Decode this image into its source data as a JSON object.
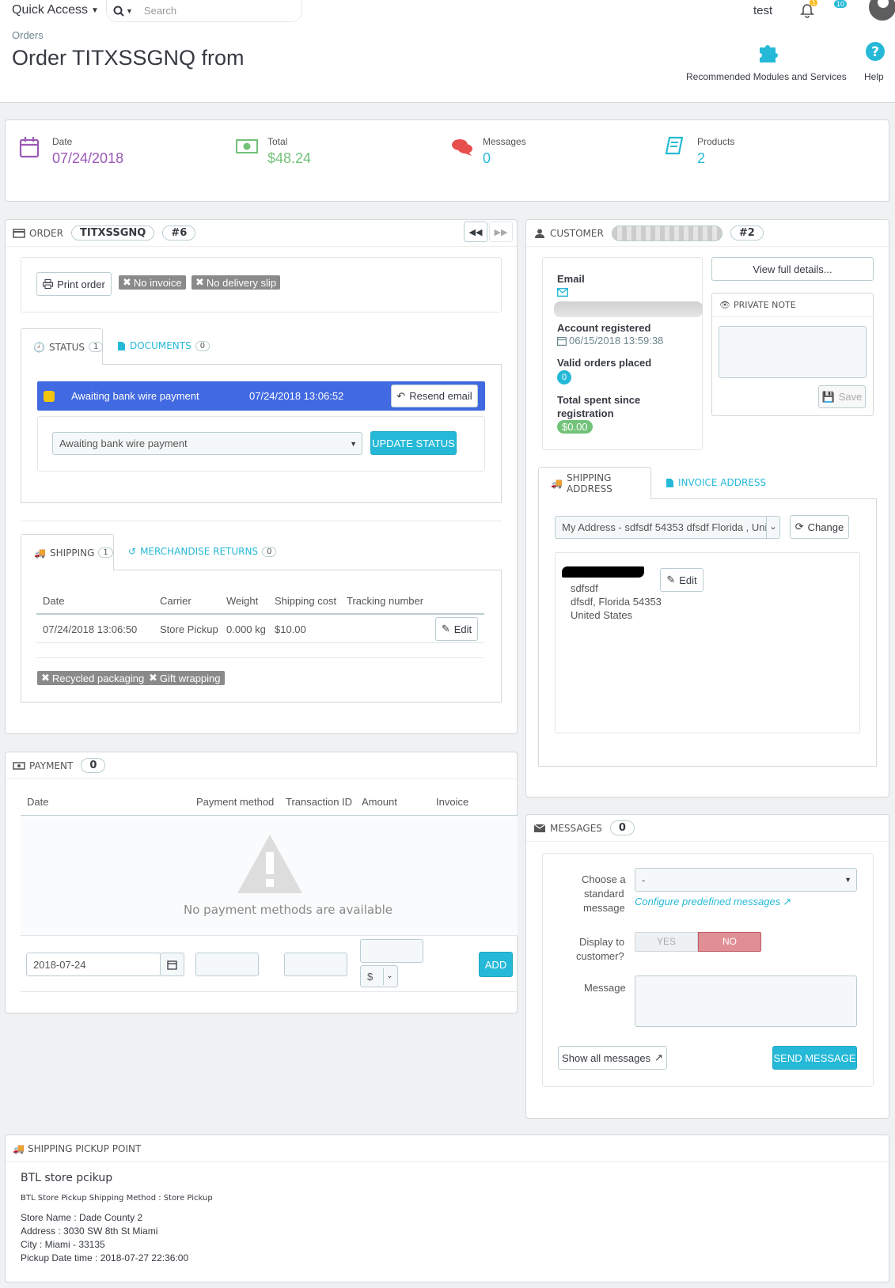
{
  "header": {
    "quick_access": "Quick Access",
    "search_placeholder": "Search",
    "user": "test",
    "notif_count": "1",
    "badge_count": "10",
    "breadcrumb": "Orders",
    "title": "Order TITXSSGNQ from",
    "recommended": "Recommended Modules and Services",
    "help": "Help"
  },
  "kpis": [
    {
      "label": "Date",
      "value": "07/24/2018",
      "color": "#9b59b6"
    },
    {
      "label": "Total",
      "value": "$48.24",
      "color": "#72c279"
    },
    {
      "label": "Messages",
      "value": "0",
      "color": "#25b9d7"
    },
    {
      "label": "Products",
      "value": "2",
      "color": "#25b9d7"
    }
  ],
  "order": {
    "heading": "ORDER",
    "reference": "TITXSSGNQ",
    "id": "#6",
    "print": "Print order",
    "no_invoice": "No invoice",
    "no_delivery": "No delivery slip",
    "tab_status": "STATUS",
    "tab_status_count": "1",
    "tab_documents": "DOCUMENTS",
    "tab_documents_count": "0",
    "status_current": "Awaiting bank wire payment",
    "status_date": "07/24/2018 13:06:52",
    "resend": "Resend email",
    "status_select": "Awaiting bank wire payment",
    "update_status": "UPDATE STATUS",
    "status_color": "#4169e1"
  },
  "shipping": {
    "tab_shipping": "SHIPPING",
    "tab_shipping_count": "1",
    "tab_returns": "MERCHANDISE RETURNS",
    "tab_returns_count": "0",
    "columns": [
      "Date",
      "Carrier",
      "Weight",
      "Shipping cost",
      "Tracking number"
    ],
    "row": {
      "date": "07/24/2018 13:06:50",
      "carrier": "Store Pickup",
      "weight": "0.000 kg",
      "cost": "$10.00"
    },
    "edit": "Edit",
    "recycled": "Recycled packaging",
    "gift": "Gift wrapping"
  },
  "payment": {
    "heading": "PAYMENT",
    "count": "0",
    "columns": [
      "Date",
      "Payment method",
      "Transaction ID",
      "Amount",
      "Invoice"
    ],
    "empty": "No payment methods are available",
    "date_value": "2018-07-24",
    "currency": "$",
    "add": "ADD"
  },
  "customer": {
    "heading": "CUSTOMER",
    "id": "#2",
    "view_details": "View full details...",
    "email_label": "Email",
    "account_registered": "Account registered",
    "registered_date": "06/15/2018 13:59:38",
    "valid_orders": "Valid orders placed",
    "valid_count": "0",
    "total_spent": "Total spent since registration",
    "total_value": "$0.00",
    "private_note": "PRIVATE NOTE",
    "save": "Save"
  },
  "address": {
    "tab_shipping": "SHIPPING ADDRESS",
    "tab_invoice": "INVOICE ADDRESS",
    "select": "My Address - sdfsdf 54353 dfsdf Florida , Uni",
    "change": "Change",
    "edit": "Edit",
    "line1": "sdfsdf",
    "line2": "dfsdf, Florida 54353",
    "line3": "United States"
  },
  "messages": {
    "heading": "MESSAGES",
    "count": "0",
    "choose_l1": "Choose a",
    "choose_l2": "standard",
    "choose_l3": "message",
    "select": "-",
    "configure": "Configure predefined messages",
    "display_l1": "Display to",
    "display_l2": "customer?",
    "yes": "YES",
    "no": "NO",
    "message_label": "Message",
    "show_all": "Show all messages",
    "send": "SEND MESSAGE"
  },
  "pickup": {
    "heading": "SHIPPING PICKUP POINT",
    "name": "BTL store pcikup",
    "method": "BTL Store Pickup Shipping Method : Store Pickup",
    "store": "Store Name : Dade County 2",
    "address": "Address : 3030 SW 8th St Miami",
    "city": "City : Miami - 33135",
    "date": "Pickup Date time : 2018-07-27 22:36:00"
  }
}
